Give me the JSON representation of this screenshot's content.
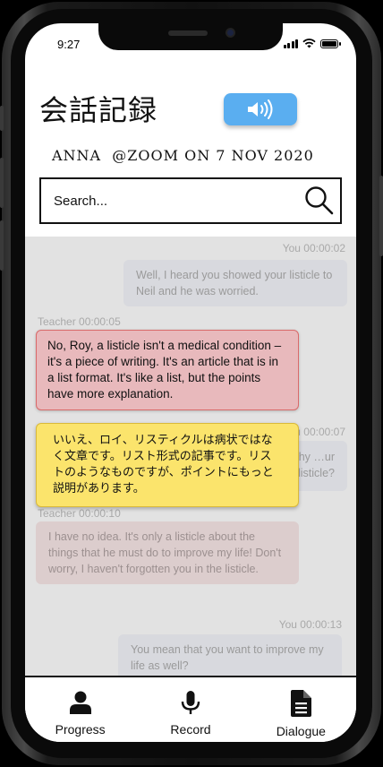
{
  "status": {
    "time": "9:27"
  },
  "header": {
    "title": "会話記録",
    "meta": "ANNA  @ZOOM ON 7 NOV 2020",
    "speaker_icon": "speaker-volume-icon",
    "accent_color": "#5aaef0"
  },
  "search": {
    "placeholder": "Search...",
    "icon": "search-icon"
  },
  "messages": [
    {
      "speaker": "You",
      "time": "You 00:00:02",
      "text": "Well, I heard you showed your listicle to Neil and he was worried."
    },
    {
      "speaker": "Teacher",
      "time": "Teacher 00:00:05",
      "text": "No, Roy, a listicle isn't a medical condition – it's a piece of writing. It's an article that is in a list format. It's like a list, but the points have more explanation."
    },
    {
      "speaker": "You",
      "time": "You 00:00:07",
      "text": "…e. But why …ur listicle?"
    },
    {
      "speaker": "Teacher",
      "time": "Teacher 00:00:10",
      "text": "I have no idea. It's only a listicle about the things that he must do to improve my life! Don't worry, I haven't forgotten you in the listicle."
    },
    {
      "speaker": "You",
      "time": "You 00:00:13",
      "text": "You mean that you want to improve my life as well?"
    }
  ],
  "translation_popup": {
    "text": "いいえ、ロイ、リスティクルは病状ではなく文章です。リスト形式の記事です。リストのようなものですが、ポイントにもっと説明があります。"
  },
  "nav": [
    {
      "label": "Progress",
      "icon": "person-icon"
    },
    {
      "label": "Record",
      "icon": "microphone-icon"
    },
    {
      "label": "Dialogue",
      "icon": "document-icon"
    }
  ],
  "colors": {
    "highlight_bg": "#e8b9bc",
    "translation_bg": "#fbe46c",
    "chat_bg": "#e2e2e2"
  }
}
